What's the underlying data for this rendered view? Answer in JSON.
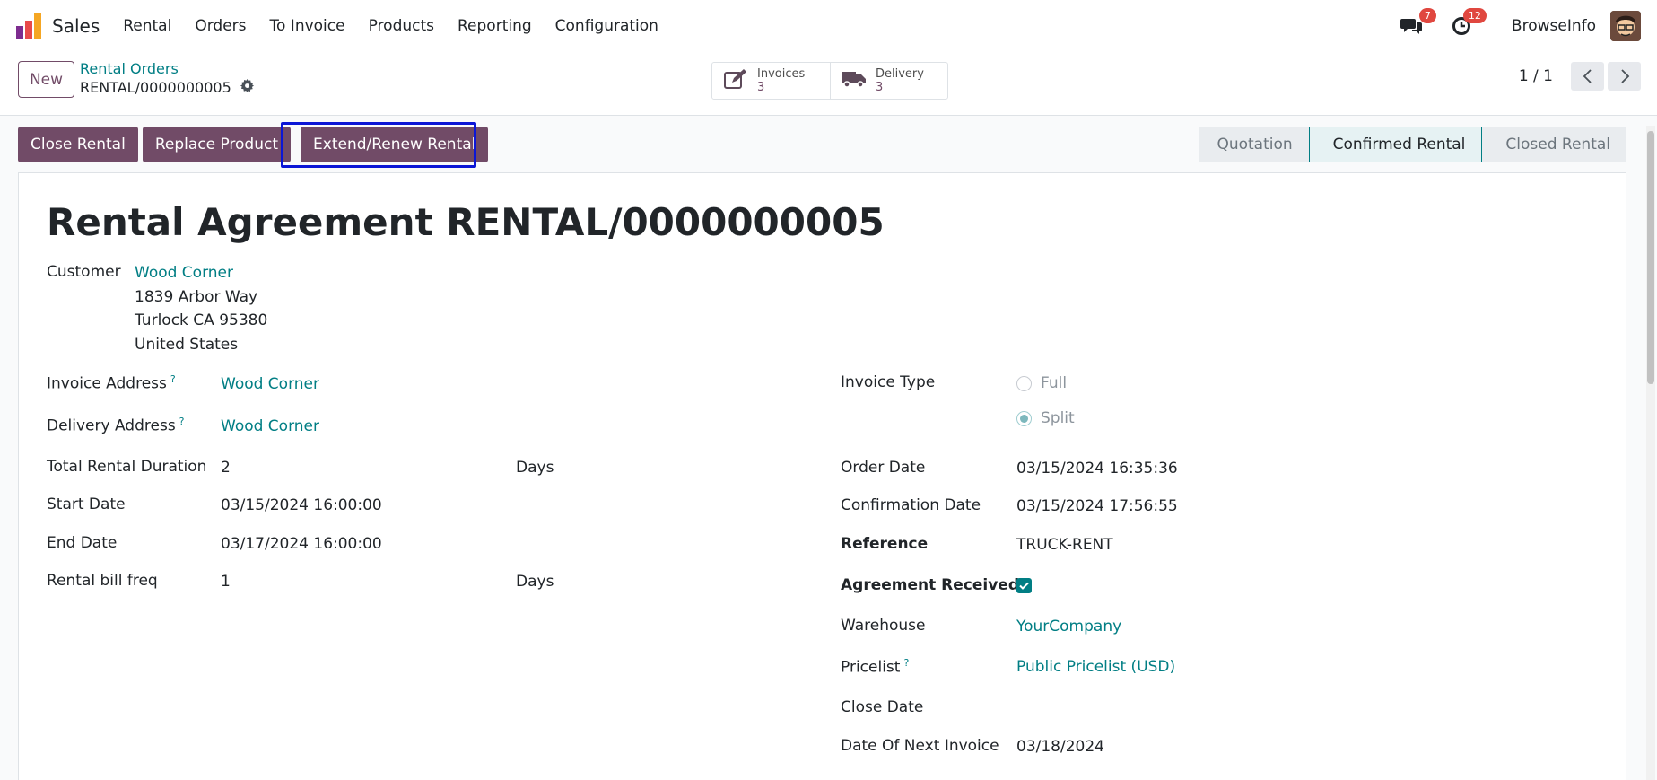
{
  "app": {
    "name": "Sales"
  },
  "nav": [
    "Rental",
    "Orders",
    "To Invoice",
    "Products",
    "Reporting",
    "Configuration"
  ],
  "systray": {
    "messages_count": "7",
    "activities_count": "12",
    "user": "BrowseInfo"
  },
  "control": {
    "new_label": "New",
    "breadcrumb_parent": "Rental Orders",
    "breadcrumb_current": "RENTAL/0000000005",
    "smart_buttons": [
      {
        "label": "Invoices",
        "value": "3",
        "icon": "pencil-square-icon"
      },
      {
        "label": "Delivery",
        "value": "3",
        "icon": "truck-icon"
      }
    ],
    "pager": "1 / 1"
  },
  "actions": [
    "Close Rental",
    "Replace Product",
    "Extend/Renew Rental"
  ],
  "status": {
    "stages": [
      "Quotation",
      "Confirmed Rental",
      "Closed Rental"
    ],
    "active": "Confirmed Rental"
  },
  "form": {
    "title": "Rental Agreement RENTAL/0000000005",
    "customer_label": "Customer",
    "customer_name": "Wood Corner",
    "customer_address": [
      "1839 Arbor Way",
      "Turlock CA 95380",
      "United States"
    ],
    "left": [
      {
        "label": "Invoice Address",
        "help": "?",
        "value": "Wood Corner",
        "link": true
      },
      {
        "label": "Delivery Address",
        "help": "?",
        "value": "Wood Corner",
        "link": true
      },
      {
        "label": "Total Rental Duration",
        "value": "2",
        "unit": "Days"
      },
      {
        "label": "Start Date",
        "value": "03/15/2024 16:00:00"
      },
      {
        "label": "End Date",
        "value": "03/17/2024 16:00:00"
      },
      {
        "label": "Rental bill freq",
        "value": "1",
        "unit": "Days"
      }
    ],
    "invoice_type": {
      "label": "Invoice Type",
      "options": [
        "Full",
        "Split"
      ],
      "selected": "Split"
    },
    "right": [
      {
        "label": "Order Date",
        "value": "03/15/2024 16:35:36"
      },
      {
        "label": "Confirmation Date",
        "value": "03/15/2024 17:56:55"
      },
      {
        "label": "Reference",
        "value": "TRUCK-RENT",
        "bold": true
      },
      {
        "label": "Agreement Received?",
        "value": "",
        "bold": true,
        "checked": true
      },
      {
        "label": "Warehouse",
        "value": "YourCompany",
        "link": true
      },
      {
        "label": "Pricelist",
        "help": "?",
        "value": "Public Pricelist (USD)",
        "link": true
      },
      {
        "label": "Close Date",
        "value": ""
      },
      {
        "label": "Date Of Next Invoice",
        "value": "03/18/2024"
      }
    ]
  },
  "colors": {
    "brand": "#714b67",
    "link": "#017e84",
    "highlight": "#0b16d6"
  }
}
